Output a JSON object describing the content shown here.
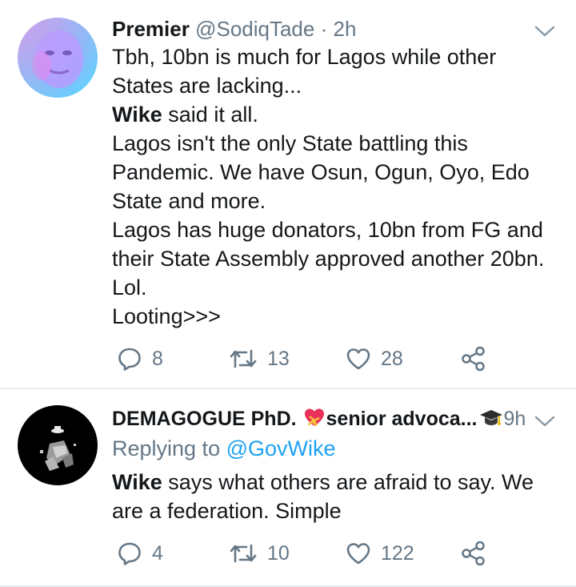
{
  "tweets": [
    {
      "author_name": "Premier",
      "author_handle": "@SodiqTade",
      "separator": "·",
      "time": "2h",
      "lines": [
        {
          "bold": "",
          "text": "Tbh, 10bn is much for Lagos while other"
        },
        {
          "bold": "",
          "text": "States are lacking..."
        },
        {
          "bold": "Wike",
          "text": " said it all."
        },
        {
          "bold": "",
          "text": "Lagos isn't the only State battling this"
        },
        {
          "bold": "",
          "text": "Pandemic. We have Osun, Ogun, Oyo, Edo"
        },
        {
          "bold": "",
          "text": "State and more."
        },
        {
          "bold": "",
          "text": "Lagos has huge donators, 10bn from FG and"
        },
        {
          "bold": "",
          "text": "their State Assembly approved another 20bn."
        },
        {
          "bold": "",
          "text": "Lol."
        },
        {
          "bold": "",
          "text": "Looting>>>"
        }
      ],
      "replies": "8",
      "retweets": "13",
      "likes": "28"
    },
    {
      "author_name": "DEMAGOGUE PhD.",
      "author_name_suffix": "senior advoca...",
      "separator": "",
      "time": "9h",
      "replying_label": "Replying to",
      "replying_mention": "@GovWike",
      "lines": [
        {
          "bold": "Wike",
          "text": " says what others are afraid to say. We"
        },
        {
          "bold": "",
          "text": "are a federation. Simple"
        }
      ],
      "replies": "4",
      "retweets": "10",
      "likes": "122"
    }
  ],
  "icons": {
    "reply": "reply-bubble-icon",
    "retweet": "retweet-icon",
    "like": "heart-icon",
    "share": "share-icon",
    "more": "chevron-down-icon",
    "emoji_heart": "heart-with-ribbon-emoji",
    "emoji_cap": "graduation-cap-emoji"
  },
  "colors": {
    "text": "#14171a",
    "muted": "#657786",
    "link": "#1da1f2",
    "divider": "#e6ecf0"
  }
}
